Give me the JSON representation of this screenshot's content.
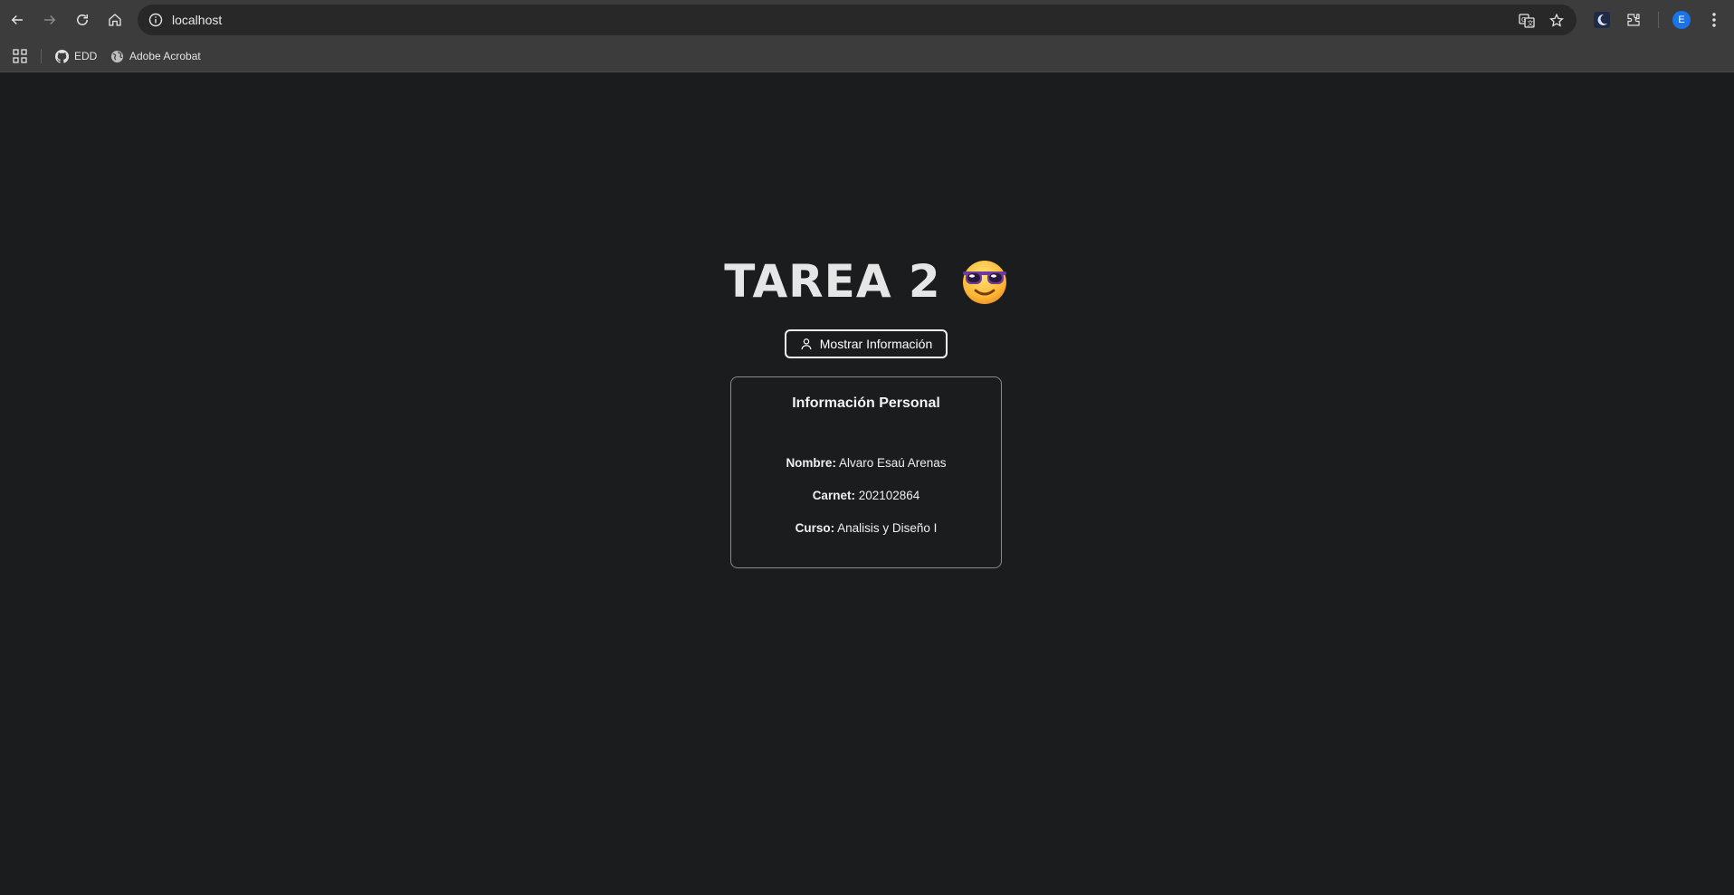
{
  "browser": {
    "url": "localhost",
    "bookmarks": [
      {
        "label": "EDD",
        "icon": "github-icon"
      },
      {
        "label": "Adobe Acrobat",
        "icon": "globe-icon"
      }
    ],
    "profile_initial": "E"
  },
  "page": {
    "title": "TAREA 2",
    "title_emoji": "smiling-face-with-sunglasses",
    "button_label": "Mostrar Información",
    "card": {
      "title": "Información Personal",
      "rows": [
        {
          "label": "Nombre:",
          "value": "Alvaro Esaú Arenas"
        },
        {
          "label": "Carnet:",
          "value": "202102864"
        },
        {
          "label": "Curso:",
          "value": "Analisis y Diseño I"
        }
      ]
    }
  },
  "colors": {
    "page_background": "#1b1c1e",
    "chrome_background": "#3c3c3c",
    "omnibox_background": "#282828",
    "profile_badge": "#1a73e8"
  }
}
